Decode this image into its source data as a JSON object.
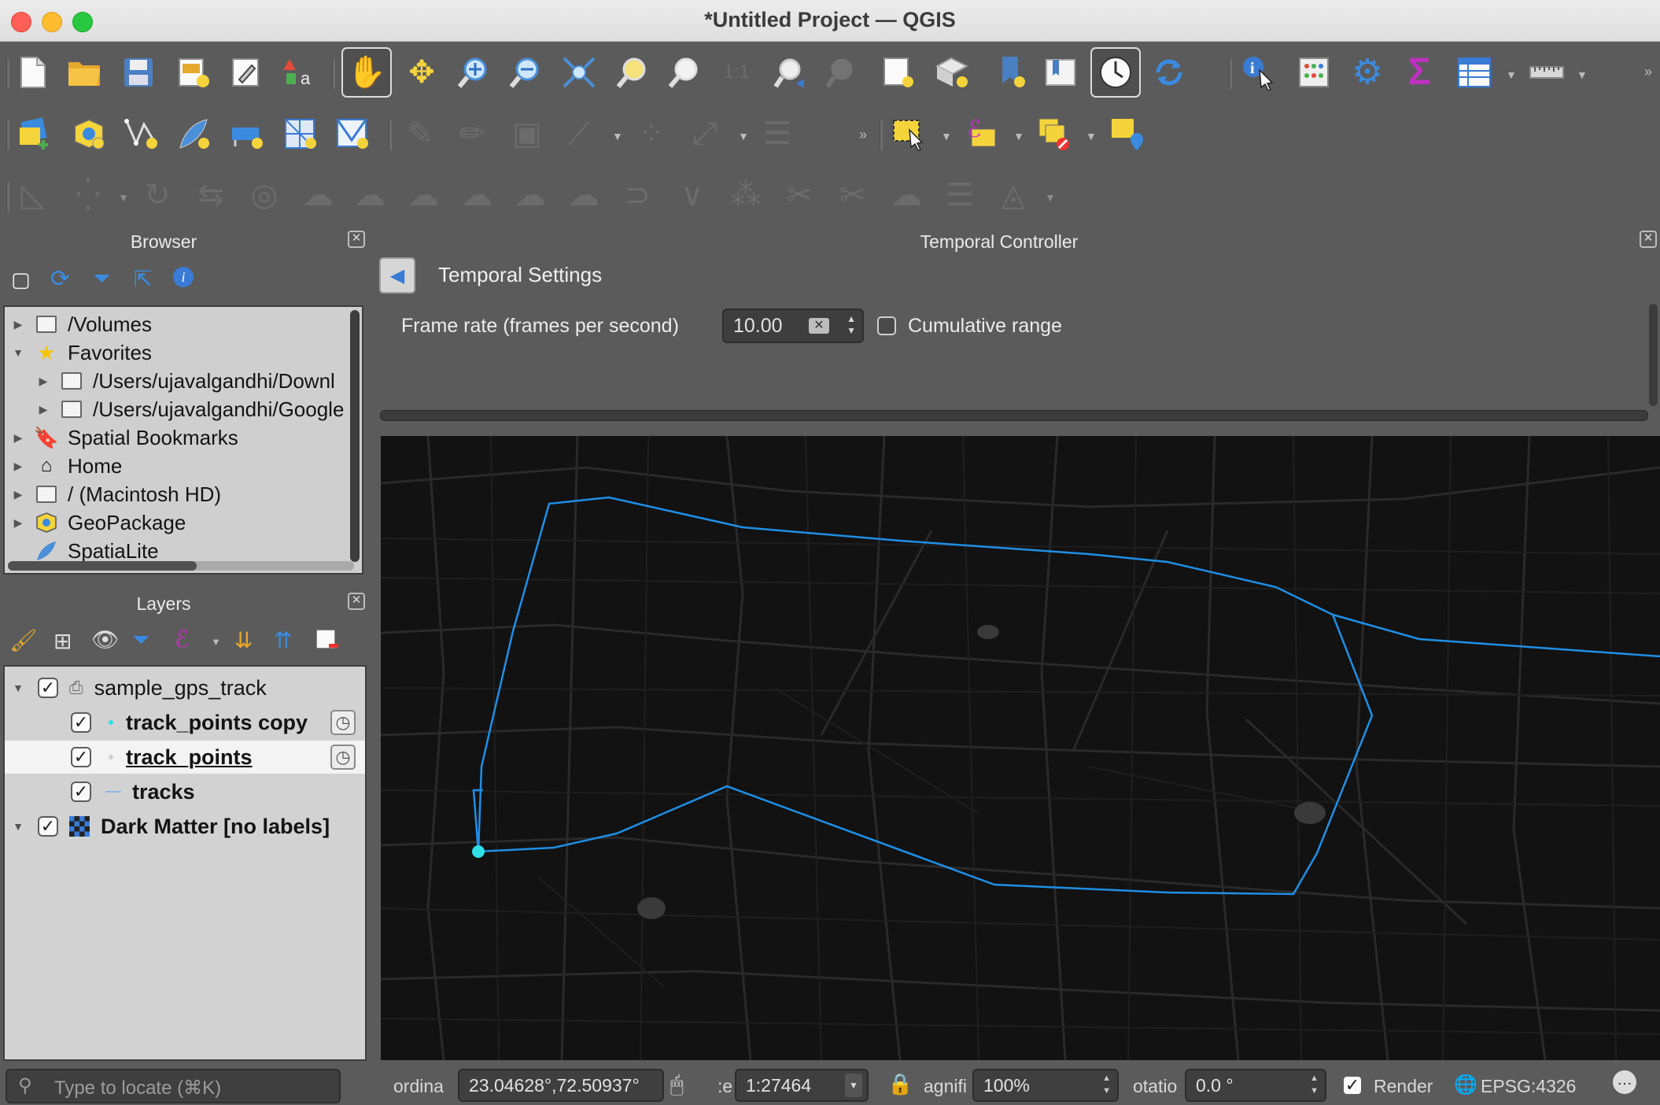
{
  "window": {
    "title": "*Untitled Project — QGIS"
  },
  "toolbars": {
    "row1": [
      "new-project",
      "open-project",
      "save-project",
      "new-print-layout",
      "layout-manager",
      "style-manager",
      "pan-map",
      "pan-to-selection",
      "zoom-in",
      "zoom-out",
      "zoom-full",
      "zoom-to-selection",
      "zoom-to-layer",
      "zoom-native",
      "zoom-last",
      "zoom-next",
      "new-map-view",
      "new-3d-view",
      "new-bookmark",
      "show-bookmarks",
      "temporal-controller",
      "refresh",
      "identify",
      "attribute-table-stats",
      "processing-toolbox",
      "statistical-summary",
      "open-attribute-table",
      "measure"
    ],
    "row2": [
      "data-source-manager",
      "new-geopackage-layer",
      "new-shapefile-layer",
      "new-spatialite-layer",
      "new-virtual-layer",
      "new-temporary-layer",
      "new-mesh-layer",
      "current-edits",
      "toggle-editing",
      "save-edits",
      "digitize",
      "vertex-tool",
      "modify-attributes",
      "select-features",
      "select-by-expression",
      "deselect",
      "select-by-location"
    ],
    "row3": [
      "advanced-digitizing",
      "move-feature",
      "rotate-feature",
      "simplify",
      "add-ring",
      "add-part",
      "fill-ring",
      "delete-ring",
      "delete-part",
      "reshape",
      "offset-curve",
      "split-features",
      "split-parts",
      "merge-features",
      "merge-attributes",
      "rotate-point",
      "reverse-line",
      "trim-extend"
    ]
  },
  "browser": {
    "title": "Browser",
    "items": [
      {
        "label": "/Volumes",
        "icon": "folder-icon",
        "indent": 0
      },
      {
        "label": "Favorites",
        "icon": "star-icon",
        "indent": 0,
        "expanded": true
      },
      {
        "label": "/Users/ujavalgandhi/Downl",
        "icon": "folder-icon",
        "indent": 1
      },
      {
        "label": "/Users/ujavalgandhi/Google",
        "icon": "folder-icon",
        "indent": 1
      },
      {
        "label": "Spatial Bookmarks",
        "icon": "bookmark-icon",
        "indent": 0
      },
      {
        "label": "Home",
        "icon": "home-icon",
        "indent": 0
      },
      {
        "label": "/ (Macintosh HD)",
        "icon": "folder-icon",
        "indent": 0
      },
      {
        "label": "GeoPackage",
        "icon": "geopackage-icon",
        "indent": 0
      },
      {
        "label": "SpatiaLite",
        "icon": "feather-icon",
        "indent": 0
      }
    ]
  },
  "layers": {
    "title": "Layers",
    "items": [
      {
        "label": "sample_gps_track",
        "type": "group",
        "checked": true,
        "bold": false
      },
      {
        "label": "track_points copy",
        "type": "point",
        "checked": true,
        "bold": true,
        "temporal": true
      },
      {
        "label": "track_points",
        "type": "point",
        "checked": true,
        "bold": true,
        "underline": true,
        "temporal": true,
        "selected": true
      },
      {
        "label": "tracks",
        "type": "line",
        "checked": true,
        "bold": true
      },
      {
        "label": "Dark Matter [no labels]",
        "type": "raster",
        "checked": true,
        "bold": true
      }
    ]
  },
  "temporal": {
    "title": "Temporal Controller",
    "settings_title": "Temporal Settings",
    "frame_rate_label": "Frame rate (frames per second)",
    "frame_rate_value": "10.00",
    "cumulative_label": "Cumulative range",
    "cumulative_checked": false
  },
  "statusbar": {
    "locator_placeholder": "Type to locate (⌘K)",
    "coordinate_label": "ordina",
    "coordinate_value": "23.04628°,72.50937°",
    "scale_label": ":e",
    "scale_value": "1:27464",
    "magnifier_label": "agnifi",
    "magnifier_value": "100%",
    "rotation_label": "otatio",
    "rotation_value": "0.0 °",
    "render_label": "Render",
    "render_checked": true,
    "crs": "EPSG:4326"
  },
  "colors": {
    "track_line": "#1f8fe6",
    "current_point": "#2fe0e6",
    "map_background": "#121212"
  }
}
